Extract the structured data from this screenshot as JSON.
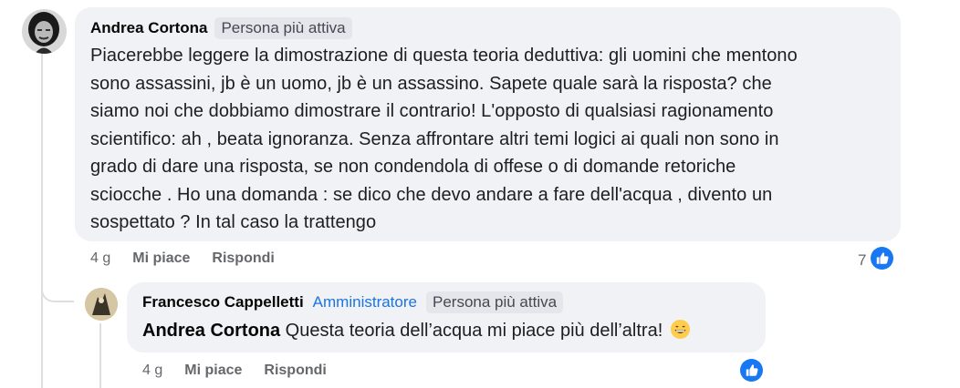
{
  "comment": {
    "author": "Andrea Cortona",
    "badge": "Persona più attiva",
    "text": "Piacerebbe leggere la dimostrazione di questa teoria deduttiva: gli uomini che mentono\nsono assassini, jb è un uomo, jb è un assassino. Sapete quale sarà la risposta? che\nsiamo noi che dobbiamo dimostrare il contrario! L'opposto di qualsiasi ragionamento\nscientifico: ah , beata ignoranza. Senza affrontare altri temi logici ai quali non sono in\ngrado di dare una risposta, se non condendola di offese o di domande retoriche\nsciocche . Ho una domanda : se dico che devo andare a fare dell'acqua , divento un\nsospettato ? In tal caso la trattengo",
    "time": "4 g",
    "like_label": "Mi piace",
    "reply_label": "Rispondi",
    "reaction_count": "7"
  },
  "reply": {
    "author": "Francesco Cappelletti",
    "badge_admin": "Amministratore",
    "badge": "Persona più attiva",
    "mention": "Andrea Cortona",
    "text": " Questa teoria dell’acqua mi piace più dell’altra! ",
    "time": "4 g",
    "like_label": "Mi piace",
    "reply_label": "Rispondi"
  },
  "colors": {
    "bubble": "#f0f2f5",
    "accent": "#1b74e4",
    "like_blue": "#1877f2",
    "meta": "#65676b"
  },
  "icons": {
    "reaction": "like-thumb-icon",
    "emoji": "grinning-face-emoji"
  }
}
